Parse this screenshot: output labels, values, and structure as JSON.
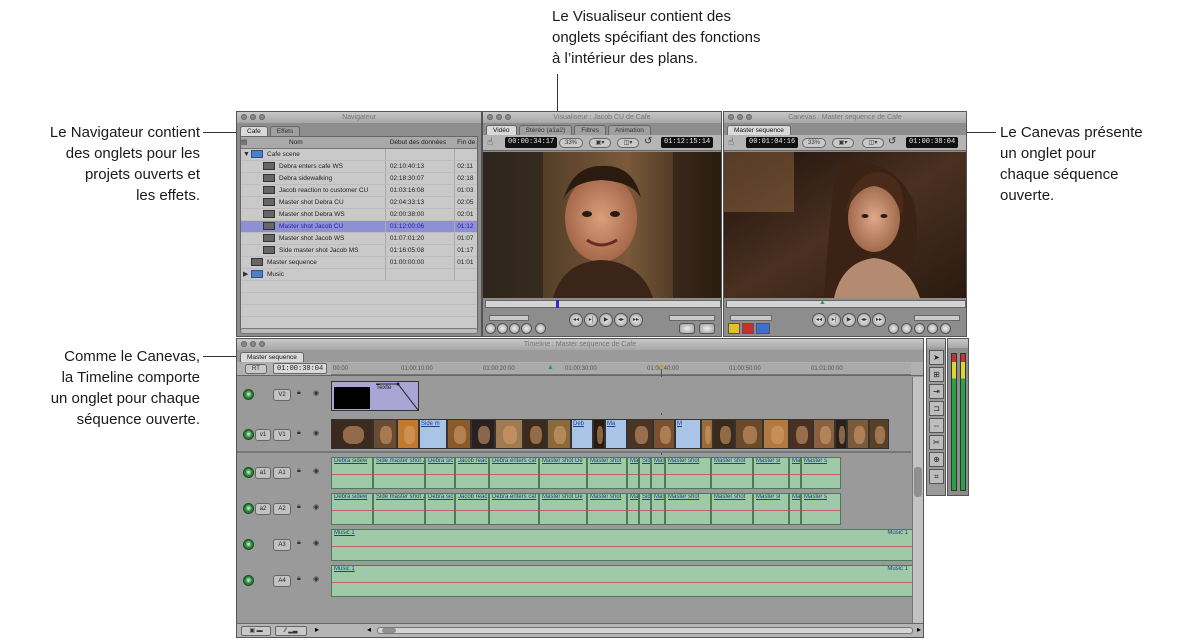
{
  "callouts": {
    "navigator": [
      "Le Navigateur contient",
      "des onglets pour les",
      "projets ouverts et",
      "les effets."
    ],
    "viewer": [
      "Le Visualiseur contient des",
      "onglets spécifiant des fonctions",
      "à l’intérieur des plans."
    ],
    "canvas": [
      "Le Canevas présente",
      "un onglet pour",
      "chaque séquence",
      "ouverte."
    ],
    "timeline": [
      "Comme le Canevas,",
      "la Timeline comporte",
      "un onglet pour chaque",
      "séquence ouverte."
    ]
  },
  "browser": {
    "title": "Navigateur",
    "tabs": [
      "Cafe",
      "Effets"
    ],
    "columns": [
      "Nom",
      "Début des données",
      "Fin de"
    ],
    "items": [
      {
        "name": "Cafe scene",
        "start": "",
        "end": "",
        "kind": "bin"
      },
      {
        "name": "Debra enters cafe WS",
        "start": "02:10:40:13",
        "end": "02:11",
        "kind": "clip"
      },
      {
        "name": "Debra sidewalking",
        "start": "02:18:30:07",
        "end": "02:18",
        "kind": "clip"
      },
      {
        "name": "Jacob reaction to customer CU",
        "start": "01:03:16:08",
        "end": "01:03",
        "kind": "clip"
      },
      {
        "name": "Master shot Debra CU",
        "start": "02:04:33:13",
        "end": "02:05",
        "kind": "clip"
      },
      {
        "name": "Master shot Debra WS",
        "start": "02:00:38:00",
        "end": "02:01",
        "kind": "clip"
      },
      {
        "name": "Master shot Jacob CU",
        "start": "01:12:00:06",
        "end": "01:12",
        "kind": "clip",
        "selected": true
      },
      {
        "name": "Master shot Jacob WS",
        "start": "01:07:01:20",
        "end": "01:07",
        "kind": "clip"
      },
      {
        "name": "Side master shot Jacob MS",
        "start": "01:16:05:08",
        "end": "01:17",
        "kind": "clip"
      },
      {
        "name": "Master sequence",
        "start": "01:00:00:00",
        "end": "01:01",
        "kind": "seq"
      },
      {
        "name": "Music",
        "start": "",
        "end": "",
        "kind": "bin"
      }
    ]
  },
  "viewer": {
    "title": "Visualiseur : Jacob CU de Cafe",
    "tabs": [
      "Vidéo",
      "Stéréo (a1a2)",
      "Filtres",
      "Animation"
    ],
    "timecode_dur": "00:00:34:17",
    "zoom": "33%",
    "timecode_cur": "01:12:15:14"
  },
  "canvas": {
    "title": "Canevas : Master sequence de Cafe",
    "tabs": [
      "Master sequence"
    ],
    "timecode_dur": "00:01:04:16",
    "zoom": "33%",
    "timecode_cur": "01:00:38:04"
  },
  "timeline": {
    "title": "Timeline : Master sequence de Cafe",
    "tabs": [
      "Master sequence"
    ],
    "timecode": "01:00:38:04",
    "rt_label": "RT",
    "ruler": [
      "00:00",
      "01:00:10:00",
      "01:00:20:00",
      "01:00:30:00",
      "01:00:40:00",
      "01:00:50:00",
      "01:01:00:00"
    ],
    "tracks": [
      {
        "dest": "",
        "name": "V2"
      },
      {
        "dest": "v1",
        "name": "V1"
      },
      {
        "dest": "a1",
        "name": "A1"
      },
      {
        "dest": "a2",
        "name": "A2"
      },
      {
        "dest": "",
        "name": "A3"
      },
      {
        "dest": "",
        "name": "A4"
      }
    ],
    "v2_clip": "Texte",
    "audio_clips": [
      "Debra sidew",
      "Side master shot Ja",
      "Debra sic",
      "Jacob reac",
      "Debra enters caf",
      "Master shot De",
      "Master shot",
      "Mas",
      "Side",
      "Mas",
      "Master shot",
      "Master shot",
      "Master sl",
      "Mas",
      "Master s"
    ],
    "v1_clips": [
      "Side m",
      "Deb",
      "Ma",
      "M"
    ],
    "music_label": "Music 1"
  }
}
